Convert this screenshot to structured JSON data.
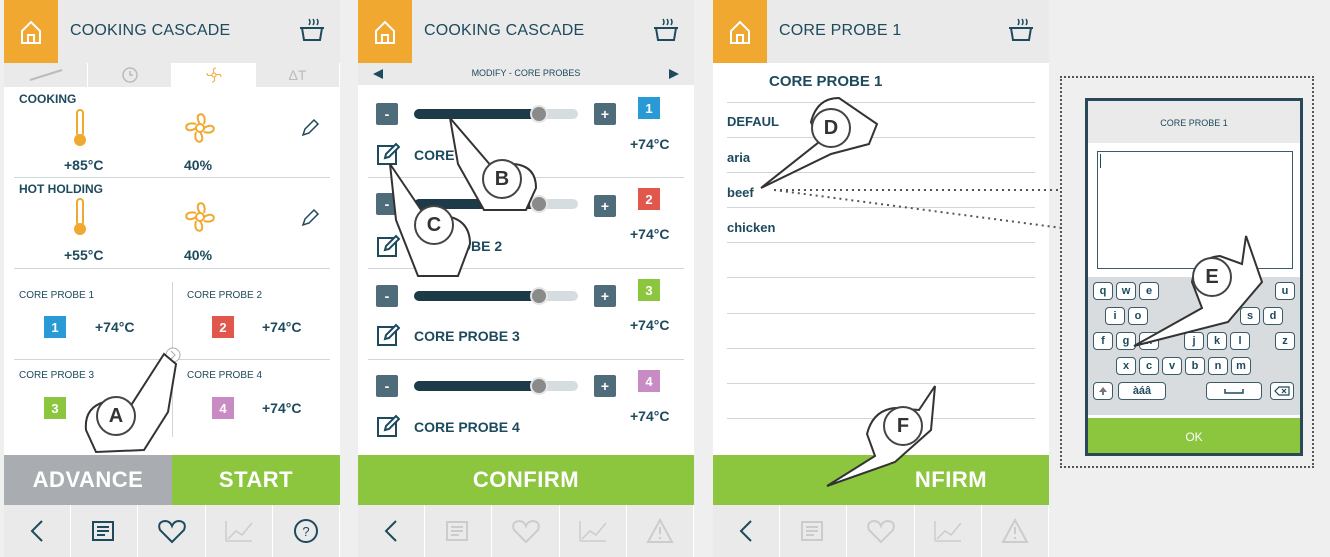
{
  "screen1": {
    "title": "COOKING CASCADE",
    "tabs": [
      "",
      "",
      "",
      "ΔT"
    ],
    "cooking": {
      "label": "COOKING",
      "temp": "+85°C",
      "fan": "40%"
    },
    "holding": {
      "label": "HOT HOLDING",
      "temp": "+55°C",
      "fan": "40%"
    },
    "probes": [
      {
        "label": "CORE PROBE 1",
        "num": "1",
        "temp": "+74°C",
        "color": "#2a9ad6"
      },
      {
        "label": "CORE PROBE 2",
        "num": "2",
        "temp": "+74°C",
        "color": "#e2574c"
      },
      {
        "label": "CORE PROBE 3",
        "num": "3",
        "temp": "",
        "color": "#8cc63f"
      },
      {
        "label": "CORE PROBE 4",
        "num": "4",
        "temp": "+74°C",
        "color": "#c98bc4"
      }
    ],
    "advance_label": "ADVANCE",
    "start_label": "START",
    "help_label": "?",
    "hand_label": "A"
  },
  "screen2": {
    "title": "COOKING CASCADE",
    "modify_label": "MODIFY - CORE PROBES",
    "rows": [
      {
        "name": "CORE",
        "num": "1",
        "temp": "+74°C",
        "color": "#2a9ad6",
        "level": 0.76
      },
      {
        "name": "ROBE 2",
        "num": "2",
        "temp": "+74°C",
        "color": "#e2574c",
        "level": 0.76
      },
      {
        "name": "CORE PROBE 3",
        "num": "3",
        "temp": "+74°C",
        "color": "#8cc63f",
        "level": 0.76
      },
      {
        "name": "CORE PROBE 4",
        "num": "4",
        "temp": "+74°C",
        "color": "#c98bc4",
        "level": 0.76
      }
    ],
    "minus": "-",
    "plus": "+",
    "confirm_label": "CONFIRM",
    "hand_b": "B",
    "hand_c": "C"
  },
  "screen3": {
    "title": "CORE PROBE 1",
    "list_title": "CORE PROBE 1",
    "items": [
      "DEFAUL",
      "aria",
      "beef",
      "chicken"
    ],
    "confirm_label": "NFIRM",
    "hand_d": "D",
    "hand_f": "F"
  },
  "keyboard": {
    "title": "CORE PROBE 1",
    "row1": [
      "q",
      "w",
      "e",
      "u"
    ],
    "row2": [
      "i",
      "o",
      "s",
      "d"
    ],
    "row3": [
      "f",
      "g",
      "n",
      "j",
      "k",
      "l",
      "z"
    ],
    "row4": [
      "x",
      "c",
      "v",
      "b",
      "n",
      "m"
    ],
    "accent_key": "àáâ",
    "ok_label": "OK",
    "hand_e": "E"
  },
  "colors": {
    "accent_orange": "#f0a830",
    "green": "#8cc63f",
    "grey_btn": "#a9adb1",
    "dark_blue": "#1d4a5c"
  }
}
